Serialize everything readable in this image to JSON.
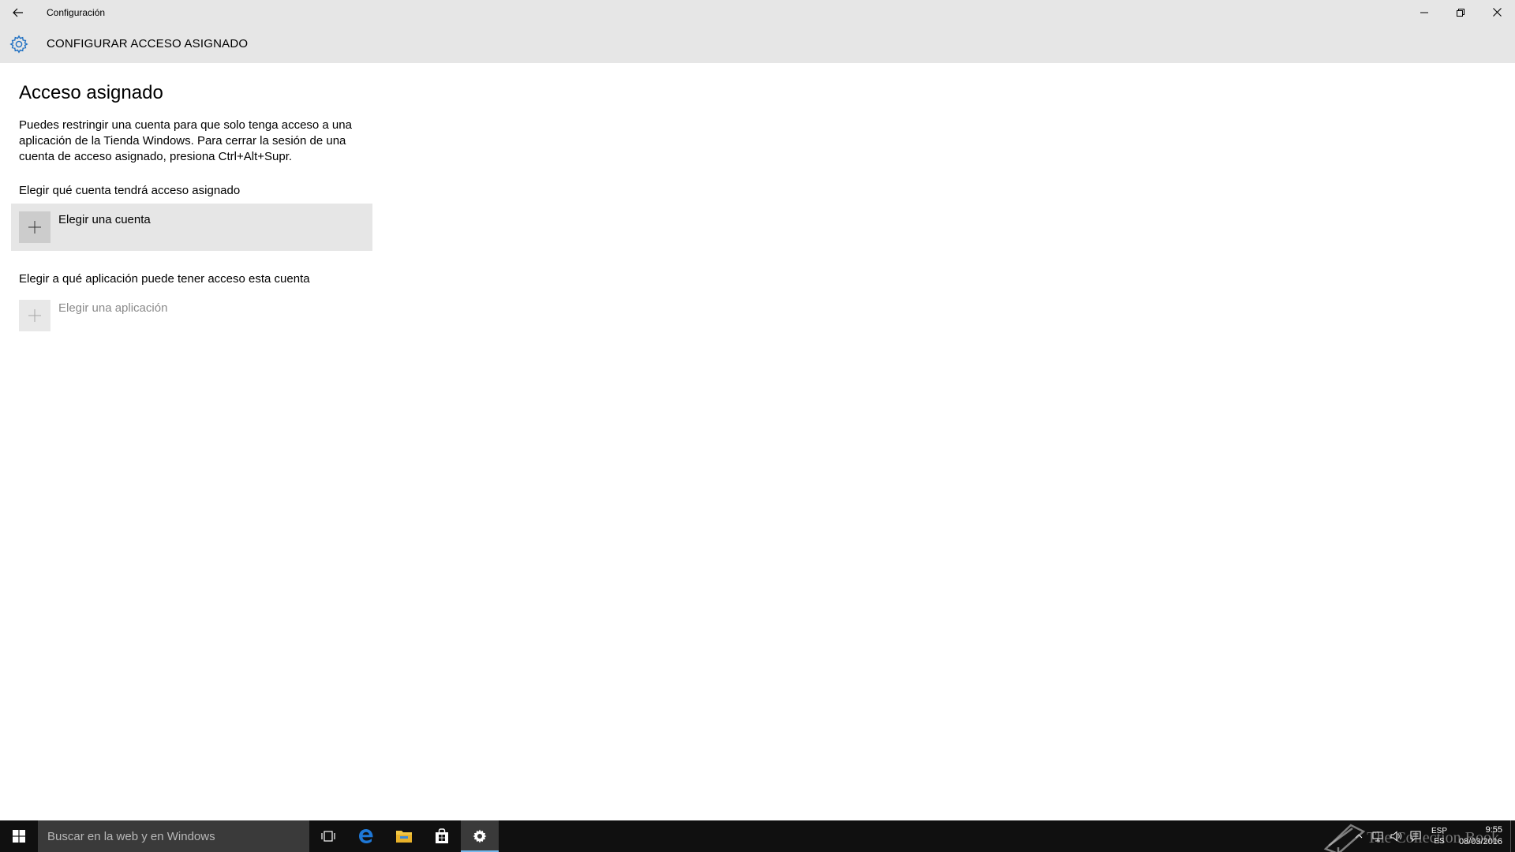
{
  "window": {
    "title": "Configuración"
  },
  "header": {
    "title": "CONFIGURAR ACCESO ASIGNADO"
  },
  "main": {
    "page_title": "Acceso asignado",
    "description": "Puedes restringir una cuenta para que solo tenga acceso a una aplicación de la Tienda Windows. Para cerrar la sesión de una cuenta de acceso asignado, presiona Ctrl+Alt+Supr.",
    "account_section_label": "Elegir qué cuenta tendrá acceso asignado",
    "account_picker_label": "Elegir una cuenta",
    "app_section_label": "Elegir a qué aplicación puede tener acceso esta cuenta",
    "app_picker_label": "Elegir una aplicación"
  },
  "taskbar": {
    "search_placeholder": "Buscar en la web y en Windows",
    "apps": [
      "task-view-icon",
      "edge-icon",
      "file-explorer-icon",
      "store-icon",
      "settings-icon"
    ],
    "language_top": "ESP",
    "language_bottom": "ES",
    "time": "9:55",
    "date": "08/03/2016",
    "watermark": "The Collection Book"
  },
  "colors": {
    "accent": "#1e6fc2",
    "chrome": "#e6e6e6",
    "taskbar": "#101010"
  }
}
